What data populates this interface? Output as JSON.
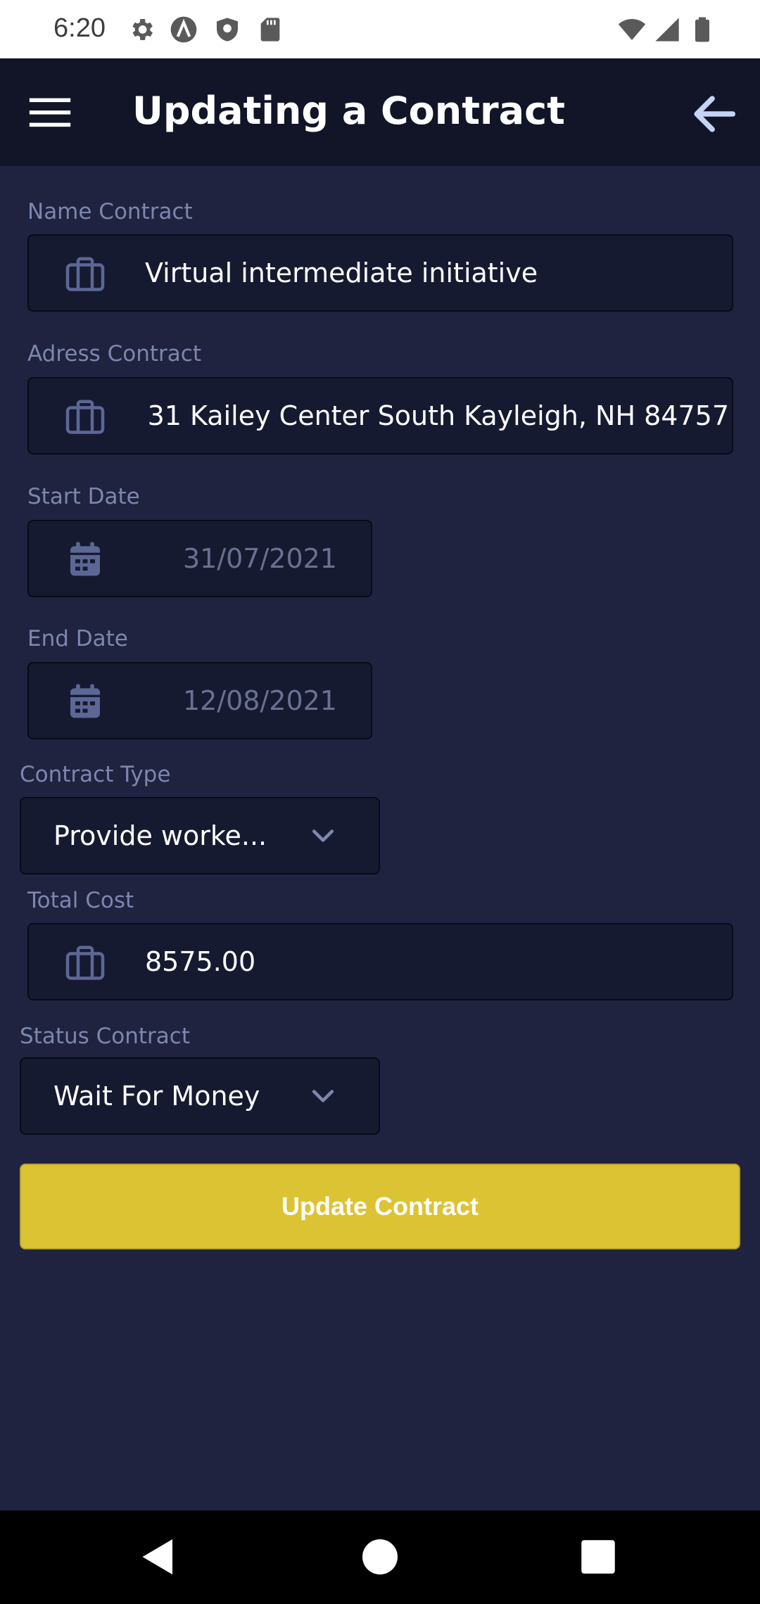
{
  "status_bar": {
    "time": "6:20",
    "left_icons": [
      "settings-icon",
      "a-icon",
      "shield-icon",
      "sd-card-icon"
    ],
    "right_icons": [
      "wifi-icon",
      "signal-icon",
      "battery-icon"
    ]
  },
  "app_bar": {
    "title": "Updating a Contract",
    "menu_icon": "hamburger-menu-icon",
    "back_icon": "arrow-back-icon"
  },
  "form": {
    "name": {
      "label": "Name Contract",
      "value": "Virtual intermediate initiative",
      "icon": "briefcase-icon"
    },
    "address": {
      "label": "Adress Contract",
      "value": "31 Kailey Center South Kayleigh, NH 84757",
      "icon": "briefcase-icon"
    },
    "start_date": {
      "label": "Start Date",
      "value": "31/07/2021",
      "icon": "calendar-icon"
    },
    "end_date": {
      "label": "End Date",
      "value": "12/08/2021",
      "icon": "calendar-icon"
    },
    "contract_type": {
      "label": "Contract Type",
      "selected": "Provide worke..."
    },
    "total_cost": {
      "label": "Total Cost",
      "value": "8575.00",
      "icon": "briefcase-icon"
    },
    "status": {
      "label": "Status Contract",
      "selected": "Wait For Money"
    },
    "submit_label": "Update Contract"
  },
  "nav_bar": {
    "icons": [
      "back-triangle-icon",
      "home-circle-icon",
      "recents-square-icon"
    ]
  },
  "colors": {
    "background": "#1f2340",
    "app_bar": "#111527",
    "input_bg": "#161a31",
    "label": "#7d86ad",
    "accent_button": "#dcc333"
  }
}
